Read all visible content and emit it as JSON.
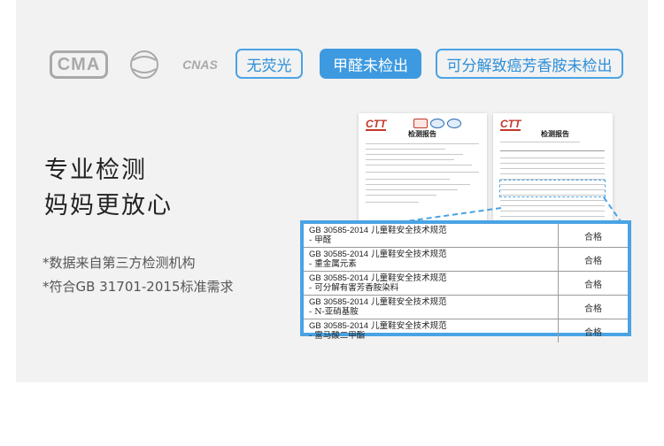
{
  "certifications": [
    {
      "name": "CMA",
      "text": "CMA",
      "icon": "cma-logo"
    },
    {
      "name": "ILAC-MRA",
      "text": "ilac-MRA",
      "icon": "ilac-mra-logo"
    },
    {
      "name": "CNAS",
      "text": "CNAS",
      "icon": "cnas-logo"
    }
  ],
  "tags": [
    {
      "label": "无荧光",
      "style": "outline"
    },
    {
      "label": "甲醛未检出",
      "style": "filled"
    },
    {
      "label": "可分解致癌芳香胺未检出",
      "style": "outline"
    }
  ],
  "heading": {
    "line1": "专业检测",
    "line2": "妈妈更放心"
  },
  "notes": [
    "*数据来自第三方检测机构",
    "*符合GB 31701-2015标准需求"
  ],
  "report": {
    "logo": "CTT",
    "title": "检测报告",
    "rows": [
      {
        "standard": "GB 30585-2014",
        "category": "儿童鞋安全技术规范",
        "item": "- 甲醛",
        "result": "合格"
      },
      {
        "standard": "GB 30585-2014",
        "category": "儿童鞋安全技术规范",
        "item": "- 重金属元素",
        "result": "合格"
      },
      {
        "standard": "GB 30585-2014",
        "category": "儿童鞋安全技术规范",
        "item": "- 可分解有害芳香胺染料",
        "result": "合格"
      },
      {
        "standard": "GB 30585-2014",
        "category": "儿童鞋安全技术规范",
        "item": "- N-亚硝基胺",
        "result": "合格"
      },
      {
        "standard": "GB 30585-2014",
        "category": "儿童鞋安全技术规范",
        "item": "- 富马酸二甲酯",
        "result": "合格"
      }
    ]
  },
  "colors": {
    "accent": "#3e9ae0",
    "panel": "#f2f2f2",
    "logo_gray": "#a9a9a9"
  }
}
